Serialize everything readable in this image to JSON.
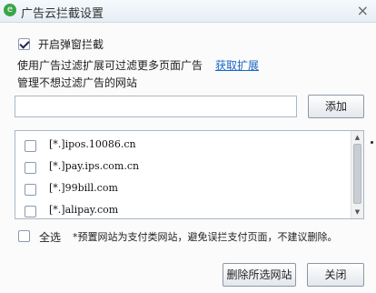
{
  "window": {
    "title": "广告云拦截设置",
    "close_glyph": "×",
    "icon": "qihoo-logo-icon"
  },
  "popup_block": {
    "label": "开启弹窗拦截",
    "checked": true
  },
  "hint": {
    "text": "使用广告过滤扩展可过滤更多页面广告",
    "link": "获取扩展"
  },
  "whitelist": {
    "heading": "管理不想过滤广告的网站",
    "input_value": "",
    "add_button": "添加",
    "items": [
      {
        "url": "[*.]ipos.10086.cn",
        "checked": false
      },
      {
        "url": "[*.]pay.ips.com.cn",
        "checked": false
      },
      {
        "url": "[*.]99bill.com",
        "checked": false
      },
      {
        "url": "[*.]alipay.com",
        "checked": false
      }
    ]
  },
  "footer": {
    "select_all": "全选",
    "note": "*预置网站为支付类网站，避免误拦支付页面，不建议删除。",
    "delete_button": "删除所选网站",
    "close_button": "关闭"
  }
}
